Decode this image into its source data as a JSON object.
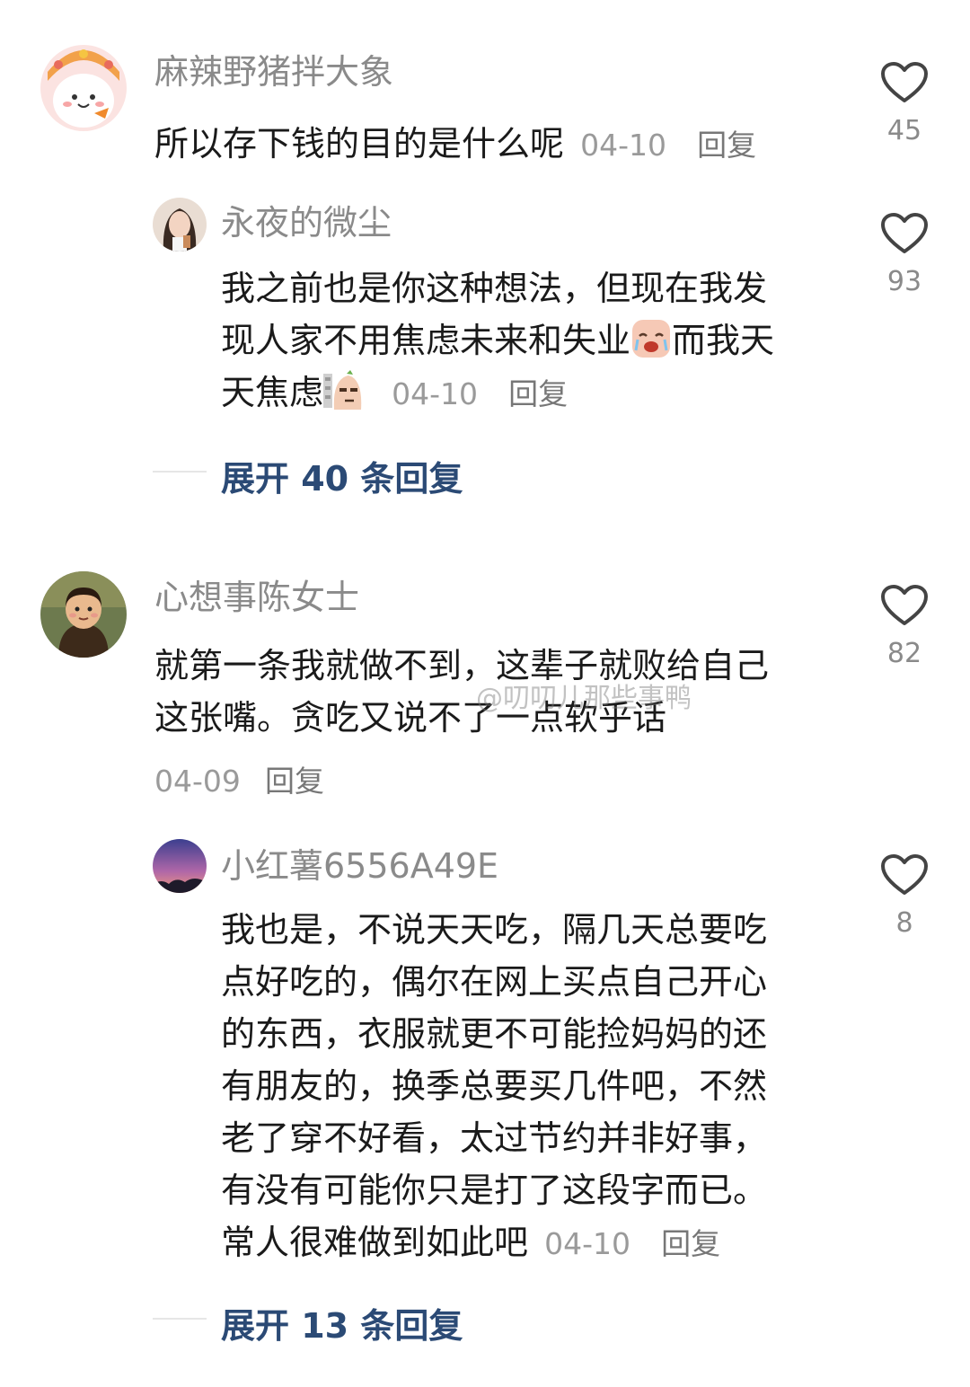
{
  "comments": [
    {
      "username": "麻辣野猪拌大象",
      "text": "所以存下钱的目的是什么呢",
      "date": "04-10",
      "reply_label": "回复",
      "likes": "45",
      "replies": [
        {
          "username": "永夜的微尘",
          "text_parts": [
            "我之前也是你这种想法，但现在我发",
            "现人家不用焦虑未来和失业",
            "而我天",
            "天焦虑"
          ],
          "date": "04-10",
          "reply_label": "回复",
          "likes": "93"
        }
      ],
      "expand": "展开 40 条回复"
    },
    {
      "username": "心想事陈女士",
      "text_lines": [
        "就第一条我就做不到，这辈子就败给自己",
        "这张嘴。贪吃又说不了一点软乎话"
      ],
      "date": "04-09",
      "reply_label": "回复",
      "likes": "82",
      "replies": [
        {
          "username": "小红薯6556A49E",
          "text_lines": [
            "我也是，不说天天吃，隔几天总要吃",
            "点好吃的，偶尔在网上买点自己开心",
            "的东西，衣服就更不可能捡妈妈的还",
            "有朋友的，换季总要买几件吧，不然",
            "老了穿不好看，太过节约并非好事，",
            "有没有可能你只是打了这段字而已。",
            "常人很难做到如此吧"
          ],
          "date": "04-10",
          "reply_label": "回复",
          "likes": "8"
        }
      ],
      "expand": "展开 13 条回复"
    }
  ],
  "watermark": "@叨叨儿那些事鸭",
  "icons": {
    "like": "heart-outline-icon",
    "emoji_1": "crying-face-emoji-icon",
    "emoji_2": "side-eye-emoji-icon"
  },
  "colors": {
    "username": "#8a8a8a",
    "text": "#1a1a1a",
    "expand": "#2b4a75",
    "meta": "#9a9a9a"
  }
}
